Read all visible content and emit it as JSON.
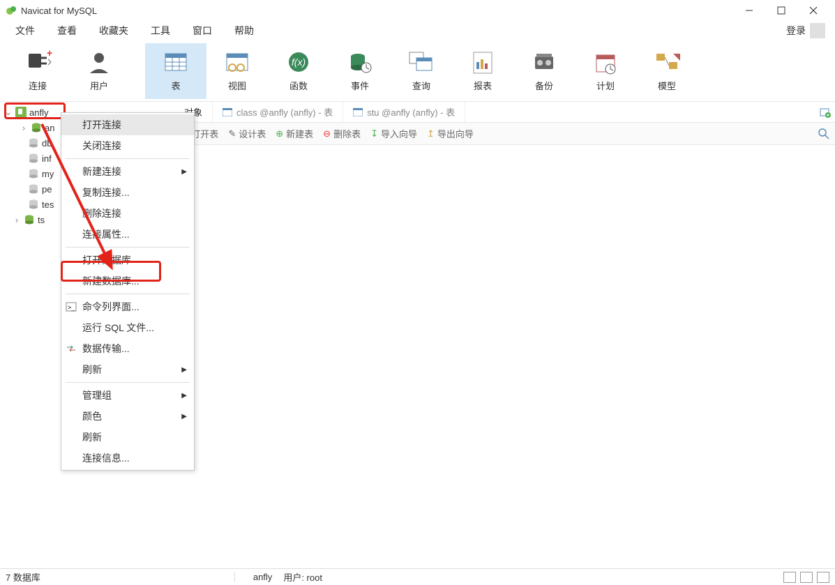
{
  "window": {
    "title": "Navicat for MySQL"
  },
  "menubar": {
    "items": [
      "文件",
      "查看",
      "收藏夹",
      "工具",
      "窗口",
      "帮助"
    ],
    "login": "登录"
  },
  "toolbar": [
    {
      "label": "连接",
      "icon": "plug"
    },
    {
      "label": "用户",
      "icon": "user"
    },
    {
      "label": "表",
      "icon": "table",
      "active": true
    },
    {
      "label": "视图",
      "icon": "view"
    },
    {
      "label": "函数",
      "icon": "fx"
    },
    {
      "label": "事件",
      "icon": "event"
    },
    {
      "label": "查询",
      "icon": "query"
    },
    {
      "label": "报表",
      "icon": "report"
    },
    {
      "label": "备份",
      "icon": "backup"
    },
    {
      "label": "计划",
      "icon": "schedule"
    },
    {
      "label": "模型",
      "icon": "model"
    }
  ],
  "sidebar": {
    "items": [
      "anfly",
      "an",
      "db",
      "inf",
      "my",
      "pe",
      "tes",
      "ts"
    ]
  },
  "tabs": {
    "object": "对象",
    "t1": "class @anfly (anfly) - 表",
    "t2": "stu @anfly (anfly) - 表"
  },
  "subtoolbar": {
    "open": "打开表",
    "design": "设计表",
    "new": "新建表",
    "delete": "删除表",
    "import": "导入向导",
    "export": "导出向导"
  },
  "context_menu": {
    "open_conn": "打开连接",
    "close_conn": "关闭连接",
    "new_conn": "新建连接",
    "dup_conn": "复制连接...",
    "del_conn": "删除连接",
    "conn_prop": "连接属性...",
    "open_db": "打开数据库",
    "new_db": "新建数据库...",
    "cmd": "命令列界面...",
    "run_sql": "运行 SQL 文件...",
    "data_trans": "数据传输...",
    "refresh1": "刷新",
    "mgmt": "管理组",
    "color": "颜色",
    "refresh2": "刷新",
    "conn_info": "连接信息..."
  },
  "statusbar": {
    "left": "7 数据库",
    "conn": "anfly",
    "user": "用户: root"
  }
}
